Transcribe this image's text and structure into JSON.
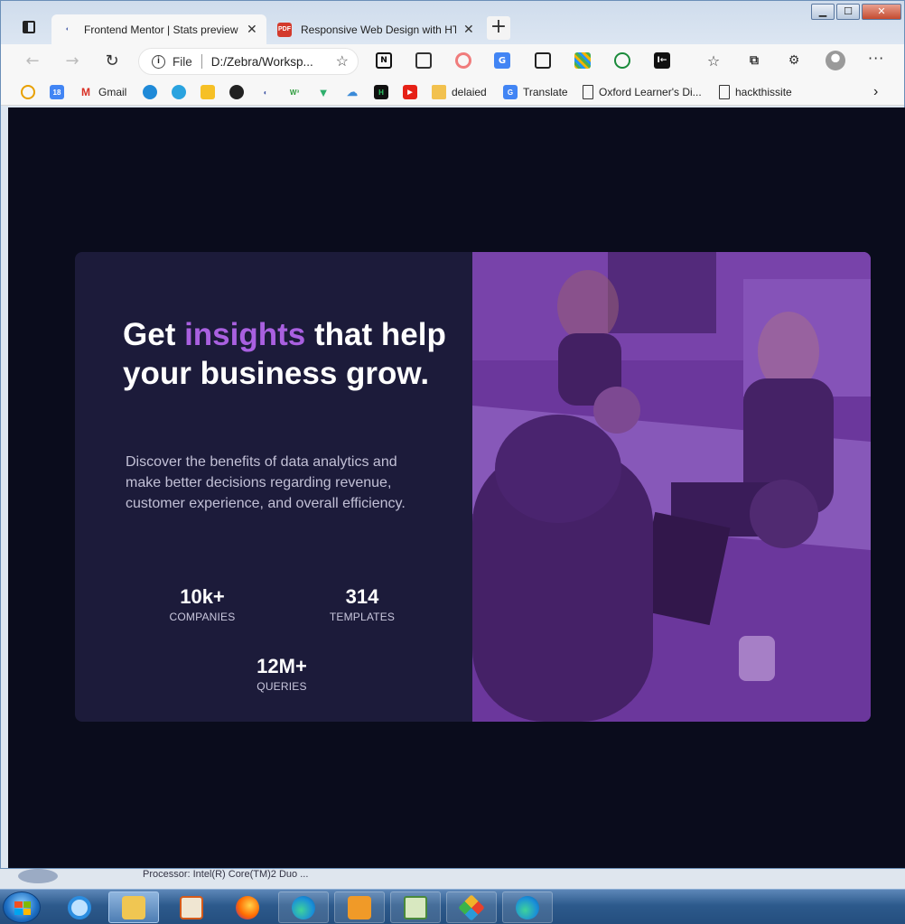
{
  "browser": {
    "tabs": [
      {
        "label": "Frontend Mentor | Stats preview",
        "active": true,
        "favicon": "frontend-mentor-icon"
      },
      {
        "label": "Responsive Web Design with HT",
        "active": false,
        "favicon": "pdf-icon",
        "favicon_text": "PDF"
      }
    ],
    "address": {
      "scheme_label": "File",
      "url": "D:/Zebra/Worksp..."
    },
    "bookmarks": [
      {
        "label": "",
        "icon": "clock-icon"
      },
      {
        "label": "",
        "icon": "calendar-icon",
        "icon_text": "18"
      },
      {
        "label": "Gmail",
        "icon": "gmail-icon",
        "icon_text": "M"
      },
      {
        "label": "",
        "icon": "globe-icon"
      },
      {
        "label": "",
        "icon": "telegram-icon"
      },
      {
        "label": "",
        "icon": "keep-icon"
      },
      {
        "label": "",
        "icon": "github-icon"
      },
      {
        "label": "",
        "icon": "frontend-mentor-icon"
      },
      {
        "label": "",
        "icon": "w3schools-icon",
        "icon_text": "W³"
      },
      {
        "label": "",
        "icon": "vue-icon"
      },
      {
        "label": "",
        "icon": "cloud-icon"
      },
      {
        "label": "",
        "icon": "hackerrank-icon",
        "icon_text": "H"
      },
      {
        "label": "",
        "icon": "youtube-icon"
      },
      {
        "label": "delaied",
        "icon": "folder-icon"
      },
      {
        "label": "Translate",
        "icon": "translate-icon"
      },
      {
        "label": "Oxford Learner's Di...",
        "icon": "page-icon"
      },
      {
        "label": "hackthissite",
        "icon": "page-icon"
      }
    ]
  },
  "page": {
    "headline_before": "Get ",
    "headline_accent": "insights",
    "headline_after": " that help your business grow.",
    "description": "Discover the benefits of data analytics and make better decisions regarding revenue, customer experience, and overall efficiency.",
    "stats": [
      {
        "value": "10k+",
        "label": "COMPANIES"
      },
      {
        "value": "314",
        "label": "TEMPLATES"
      },
      {
        "value": "12M+",
        "label": "QUERIES"
      }
    ],
    "image_alt": "office-meeting-photo"
  },
  "desktop": {
    "ghost_text": "Processor: Intel(R) Core(TM)2 Duo ..."
  },
  "colors": {
    "page_bg": "#0a0c1c",
    "card_bg": "#1c1b3a",
    "accent": "#a960e0",
    "image_overlay": "#6e3a9e"
  }
}
